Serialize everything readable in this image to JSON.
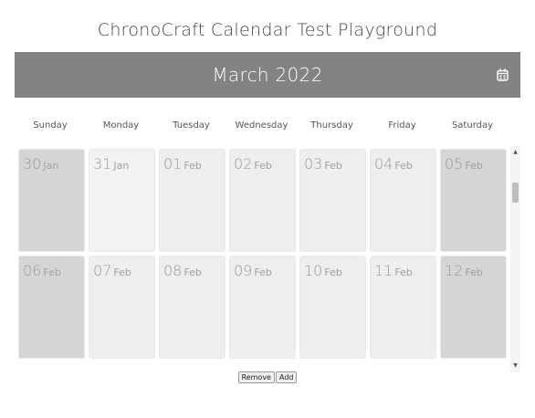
{
  "page": {
    "title": "ChronoCraft Calendar Test Playground"
  },
  "calendar": {
    "month_title": "March 2022",
    "calendar_icon": "calendar-icon",
    "weekdays": [
      "Sunday",
      "Monday",
      "Tuesday",
      "Wednesday",
      "Thursday",
      "Friday",
      "Saturday"
    ],
    "weeks": [
      [
        {
          "num": "",
          "mon": ""
        },
        {
          "num": "",
          "mon": ""
        },
        {
          "num": "",
          "mon": ""
        },
        {
          "num": "",
          "mon": ""
        },
        {
          "num": "",
          "mon": ""
        },
        {
          "num": "",
          "mon": ""
        },
        {
          "num": "",
          "mon": ""
        }
      ],
      [
        {
          "num": "30",
          "mon": "Jan"
        },
        {
          "num": "31",
          "mon": "Jan"
        },
        {
          "num": "01",
          "mon": "Feb"
        },
        {
          "num": "02",
          "mon": "Feb"
        },
        {
          "num": "03",
          "mon": "Feb"
        },
        {
          "num": "04",
          "mon": "Feb"
        },
        {
          "num": "05",
          "mon": "Feb"
        }
      ],
      [
        {
          "num": "06",
          "mon": "Feb"
        },
        {
          "num": "07",
          "mon": "Feb"
        },
        {
          "num": "08",
          "mon": "Feb"
        },
        {
          "num": "09",
          "mon": "Feb"
        },
        {
          "num": "10",
          "mon": "Feb"
        },
        {
          "num": "11",
          "mon": "Feb"
        },
        {
          "num": "12",
          "mon": "Feb"
        }
      ]
    ]
  },
  "controls": {
    "remove_label": "Remove",
    "add_label": "Add"
  },
  "colors": {
    "header_bg": "#858282",
    "weekend_cell": "#d5d5d5",
    "weekday_cell": "#eeeeee"
  }
}
